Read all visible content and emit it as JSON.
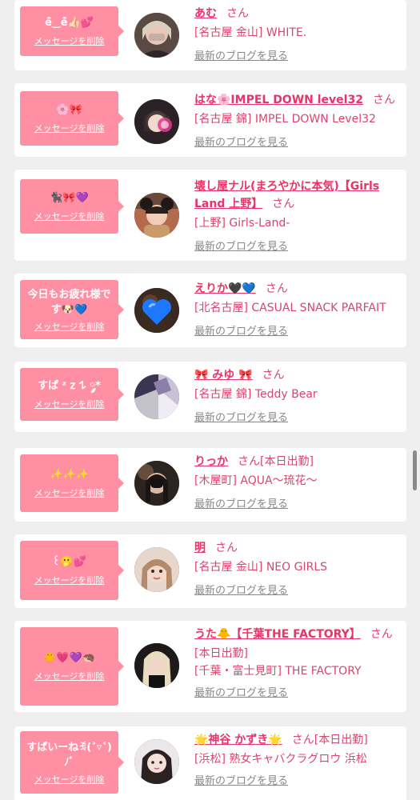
{
  "colors": {
    "accent": "#e8336b",
    "bubble": "#ff8fa3",
    "link_gray": "#888888",
    "background": "#f0efef"
  },
  "entries": [
    {
      "bubble_text": "ê̆‿ê̆👍🏻💕",
      "delete_label": "メッセージを削除",
      "name": "あむ",
      "san": "さん",
      "extra": "",
      "shop": "[名古屋 金山] WHITE.",
      "shop2": "",
      "blog_label": "最新のブログを見る",
      "avatar_icon": "avatar-photo-icon"
    },
    {
      "bubble_text": "🌸🎀",
      "delete_label": "メッセージを削除",
      "name": "はな🌸IMPEL DOWN level32",
      "san": "さん",
      "extra": "",
      "shop": "[名古屋 錦] IMPEL DOWN Level32",
      "shop2": "",
      "blog_label": "最新のブログを見る",
      "avatar_icon": "avatar-photo-icon"
    },
    {
      "bubble_text": "🐈‍⬛🎀💜",
      "delete_label": "メッセージを削除",
      "name": "壊し屋ナル(まろやかに本気)【Girls Land 上野】",
      "san": "さん",
      "extra": "",
      "shop": "[上野] Girls-Land-",
      "shop2": "",
      "blog_label": "最新のブログを見る",
      "avatar_icon": "avatar-photo-icon"
    },
    {
      "bubble_text": "今日もお疲れ様です🐶💙",
      "delete_label": "メッセージを削除",
      "name": "えりか🖤💙",
      "san": "さん",
      "extra": "",
      "shop": "[北名古屋] CASUAL SNACK PARFAIT",
      "shop2": "",
      "blog_label": "最新のブログを見る",
      "avatar_icon": "heart-avatar-icon"
    },
    {
      "bubble_text": "すぱ ᶻ 𝗓 𐰁 ༘*",
      "delete_label": "メッセージを削除",
      "name": "🎀 みゆ 🎀",
      "san": "さん",
      "extra": "",
      "shop": "[名古屋 錦] Teddy Bear",
      "shop2": "",
      "blog_label": "最新のブログを見る",
      "avatar_icon": "avatar-photo-icon"
    },
    {
      "bubble_text": "✨✨✨",
      "delete_label": "メッセージを削除",
      "name": "りっか",
      "san": "さん",
      "extra": "[本日出勤]",
      "shop": "[木屋町] AQUA～琉花～",
      "shop2": "",
      "blog_label": "最新のブログを見る",
      "avatar_icon": "avatar-photo-icon"
    },
    {
      "bubble_text": "꒰🫢💕",
      "delete_label": "メッセージを削除",
      "name": "明",
      "san": "さん",
      "extra": "",
      "shop": "[名古屋 金山] NEO GIRLS",
      "shop2": "",
      "blog_label": "最新のブログを見る",
      "avatar_icon": "avatar-photo-icon"
    },
    {
      "bubble_text": "🐥💗💜🦔",
      "delete_label": "メッセージを削除",
      "name": "うた🐥【千葉THE FACTORY】",
      "san": "さん",
      "extra": "",
      "shop": "[本日出勤]",
      "shop2": "[千葉・富士見町] THE FACTORY",
      "blog_label": "最新のブログを見る",
      "avatar_icon": "avatar-photo-icon"
    },
    {
      "bubble_text": "すぱいーねꉂ(˃▿˂)ﾉﾞ",
      "delete_label": "メッセージを削除",
      "name": "🌟神谷 かずき🌟",
      "san": "さん",
      "extra": "[本日出勤]",
      "shop": "[浜松] 熟女キャバクラグロウ 浜松",
      "shop2": "",
      "blog_label": "最新のブログを見る",
      "avatar_icon": "avatar-photo-icon"
    }
  ]
}
